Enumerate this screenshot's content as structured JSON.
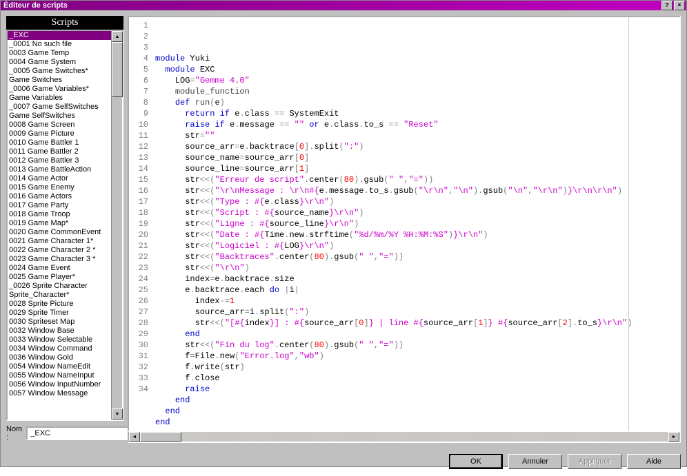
{
  "window": {
    "title": "Éditeur de scripts"
  },
  "sidebar": {
    "header": "Scripts",
    "name_label": "Nom :",
    "name_value": "_EXC",
    "items": [
      "_EXC",
      "_0001 No such file",
      "0003 Game Temp",
      "0004 Game System",
      "_0005 Game Switches*",
      "Game Switches",
      "_0006 Game Variables*",
      "Game Variables",
      "_0007 Game SelfSwitches",
      "Game SelfSwitches",
      "0008 Game Screen",
      "0009 Game Picture",
      "0010 Game Battler 1",
      "0011 Game Battler 2",
      "0012 Game Battler 3",
      "0013 Game BattleAction",
      "0014 Game Actor",
      "0015 Game Enemy",
      "0016 Game Actors",
      "0017 Game Party",
      "0018 Game Troop",
      "0019 Game Map*",
      "0020 Game CommonEvent",
      "0021 Game Character 1*",
      "0022 Game Character 2 *",
      "0023 Game Character 3 *",
      "0024 Game Event",
      "0025 Game Player*",
      "_0026 Sprite Character",
      "Sprite_Character*",
      "0028 Sprite Picture",
      "0029 Sprite Timer",
      "0030 Spriteset Map",
      "0032 Window Base",
      "0033 Window Selectable",
      "0034 Window Command",
      "0036 Window Gold",
      "0054 Window NameEdit",
      "0055 Window NameInput",
      "0056 Window InputNumber",
      "0057 Window Message"
    ],
    "selected_index": 0
  },
  "code": {
    "lines": [
      [
        [
          "kw",
          "module"
        ],
        [
          "id",
          " Yuki"
        ]
      ],
      [
        [
          "id",
          "  "
        ],
        [
          "kw",
          "module"
        ],
        [
          "id",
          " EXC"
        ]
      ],
      [
        [
          "id",
          "    LOG"
        ],
        [
          "op",
          "="
        ],
        [
          "str",
          "\"Gemme 4.0\""
        ]
      ],
      [
        [
          "id",
          "    "
        ],
        [
          "def",
          "module_function"
        ]
      ],
      [
        [
          "id",
          "    "
        ],
        [
          "kw",
          "def"
        ],
        [
          "id",
          " "
        ],
        [
          "def",
          "run"
        ],
        [
          "op",
          "("
        ],
        [
          "id",
          "e"
        ],
        [
          "op",
          ")"
        ]
      ],
      [
        [
          "id",
          "      "
        ],
        [
          "kw",
          "return"
        ],
        [
          "id",
          " "
        ],
        [
          "kw",
          "if"
        ],
        [
          "id",
          " e"
        ],
        [
          "op",
          "."
        ],
        [
          "id",
          "class "
        ],
        [
          "op",
          "=="
        ],
        [
          "id",
          " SystemExit"
        ]
      ],
      [
        [
          "id",
          "      "
        ],
        [
          "kw",
          "raise"
        ],
        [
          "id",
          " "
        ],
        [
          "kw",
          "if"
        ],
        [
          "id",
          " e"
        ],
        [
          "op",
          "."
        ],
        [
          "id",
          "message "
        ],
        [
          "op",
          "=="
        ],
        [
          "id",
          " "
        ],
        [
          "str",
          "\"\""
        ],
        [
          "id",
          " "
        ],
        [
          "kw",
          "or"
        ],
        [
          "id",
          " e"
        ],
        [
          "op",
          "."
        ],
        [
          "id",
          "class"
        ],
        [
          "op",
          "."
        ],
        [
          "id",
          "to_s "
        ],
        [
          "op",
          "=="
        ],
        [
          "id",
          " "
        ],
        [
          "str",
          "\"Reset\""
        ]
      ],
      [
        [
          "id",
          "      str"
        ],
        [
          "op",
          "="
        ],
        [
          "str",
          "\"\""
        ]
      ],
      [
        [
          "id",
          "      source_arr"
        ],
        [
          "op",
          "="
        ],
        [
          "id",
          "e"
        ],
        [
          "op",
          "."
        ],
        [
          "id",
          "backtrace"
        ],
        [
          "op",
          "["
        ],
        [
          "num",
          "0"
        ],
        [
          "op",
          "]."
        ],
        [
          "id",
          "split"
        ],
        [
          "op",
          "("
        ],
        [
          "str",
          "\":\""
        ],
        [
          "op",
          ")"
        ]
      ],
      [
        [
          "id",
          "      source_name"
        ],
        [
          "op",
          "="
        ],
        [
          "id",
          "source_arr"
        ],
        [
          "op",
          "["
        ],
        [
          "num",
          "0"
        ],
        [
          "op",
          "]"
        ]
      ],
      [
        [
          "id",
          "      source_line"
        ],
        [
          "op",
          "="
        ],
        [
          "id",
          "source_arr"
        ],
        [
          "op",
          "["
        ],
        [
          "num",
          "1"
        ],
        [
          "op",
          "]"
        ]
      ],
      [
        [
          "id",
          "      str"
        ],
        [
          "op",
          "<<("
        ],
        [
          "str",
          "\"Erreur de script\""
        ],
        [
          "op",
          "."
        ],
        [
          "id",
          "center"
        ],
        [
          "op",
          "("
        ],
        [
          "num",
          "80"
        ],
        [
          "op",
          ")."
        ],
        [
          "id",
          "gsub"
        ],
        [
          "op",
          "("
        ],
        [
          "str",
          "\" \""
        ],
        [
          "op",
          ","
        ],
        [
          "str",
          "\"=\""
        ],
        [
          "op",
          "))"
        ]
      ],
      [
        [
          "id",
          "      str"
        ],
        [
          "op",
          "<<("
        ],
        [
          "str",
          "\"\\r\\nMessage : \\r\\n#{"
        ],
        [
          "id",
          "e"
        ],
        [
          "op",
          "."
        ],
        [
          "id",
          "message"
        ],
        [
          "op",
          "."
        ],
        [
          "id",
          "to_s"
        ],
        [
          "op",
          "."
        ],
        [
          "id",
          "gsub"
        ],
        [
          "op",
          "("
        ],
        [
          "str",
          "\"\\r\\n\""
        ],
        [
          "op",
          ","
        ],
        [
          "str",
          "\"\\n\""
        ],
        [
          "op",
          ")."
        ],
        [
          "id",
          "gsub"
        ],
        [
          "op",
          "("
        ],
        [
          "str",
          "\"\\n\""
        ],
        [
          "op",
          ","
        ],
        [
          "str",
          "\"\\r\\n\""
        ],
        [
          "op",
          ")"
        ],
        [
          "str",
          "}\\r\\n\\r\\n\""
        ],
        [
          "op",
          ")"
        ]
      ],
      [
        [
          "id",
          "      str"
        ],
        [
          "op",
          "<<("
        ],
        [
          "str",
          "\"Type : #{"
        ],
        [
          "id",
          "e"
        ],
        [
          "op",
          "."
        ],
        [
          "id",
          "class"
        ],
        [
          "str",
          "}\\r\\n\""
        ],
        [
          "op",
          ")"
        ]
      ],
      [
        [
          "id",
          "      str"
        ],
        [
          "op",
          "<<("
        ],
        [
          "str",
          "\"Script : #{"
        ],
        [
          "id",
          "source_name"
        ],
        [
          "str",
          "}\\r\\n\""
        ],
        [
          "op",
          ")"
        ]
      ],
      [
        [
          "id",
          "      str"
        ],
        [
          "op",
          "<<("
        ],
        [
          "str",
          "\"Ligne : #{"
        ],
        [
          "id",
          "source_line"
        ],
        [
          "str",
          "}\\r\\n\""
        ],
        [
          "op",
          ")"
        ]
      ],
      [
        [
          "id",
          "      str"
        ],
        [
          "op",
          "<<("
        ],
        [
          "str",
          "\"Date : #{"
        ],
        [
          "id",
          "Time"
        ],
        [
          "op",
          "."
        ],
        [
          "id",
          "new"
        ],
        [
          "op",
          "."
        ],
        [
          "id",
          "strftime"
        ],
        [
          "op",
          "("
        ],
        [
          "str",
          "\"%d/%m/%Y %H:%M:%S\""
        ],
        [
          "op",
          ")"
        ],
        [
          "str",
          "}\\r\\n\""
        ],
        [
          "op",
          ")"
        ]
      ],
      [
        [
          "id",
          "      str"
        ],
        [
          "op",
          "<<("
        ],
        [
          "str",
          "\"Logiciel : #{"
        ],
        [
          "id",
          "LOG"
        ],
        [
          "str",
          "}\\r\\n\""
        ],
        [
          "op",
          ")"
        ]
      ],
      [
        [
          "id",
          "      str"
        ],
        [
          "op",
          "<<("
        ],
        [
          "str",
          "\"Backtraces\""
        ],
        [
          "op",
          "."
        ],
        [
          "id",
          "center"
        ],
        [
          "op",
          "("
        ],
        [
          "num",
          "80"
        ],
        [
          "op",
          ")."
        ],
        [
          "id",
          "gsub"
        ],
        [
          "op",
          "("
        ],
        [
          "str",
          "\" \""
        ],
        [
          "op",
          ","
        ],
        [
          "str",
          "\"=\""
        ],
        [
          "op",
          "))"
        ]
      ],
      [
        [
          "id",
          "      str"
        ],
        [
          "op",
          "<<("
        ],
        [
          "str",
          "\"\\r\\n\""
        ],
        [
          "op",
          ")"
        ]
      ],
      [
        [
          "id",
          "      index"
        ],
        [
          "op",
          "="
        ],
        [
          "id",
          "e"
        ],
        [
          "op",
          "."
        ],
        [
          "id",
          "backtrace"
        ],
        [
          "op",
          "."
        ],
        [
          "id",
          "size"
        ]
      ],
      [
        [
          "id",
          "      e"
        ],
        [
          "op",
          "."
        ],
        [
          "id",
          "backtrace"
        ],
        [
          "op",
          "."
        ],
        [
          "id",
          "each "
        ],
        [
          "kw",
          "do"
        ],
        [
          "id",
          " "
        ],
        [
          "op",
          "|"
        ],
        [
          "id",
          "i"
        ],
        [
          "op",
          "|"
        ]
      ],
      [
        [
          "id",
          "        index"
        ],
        [
          "op",
          "-="
        ],
        [
          "num",
          "1"
        ]
      ],
      [
        [
          "id",
          "        source_arr"
        ],
        [
          "op",
          "="
        ],
        [
          "id",
          "i"
        ],
        [
          "op",
          "."
        ],
        [
          "id",
          "split"
        ],
        [
          "op",
          "("
        ],
        [
          "str",
          "\":\""
        ],
        [
          "op",
          ")"
        ]
      ],
      [
        [
          "id",
          "        str"
        ],
        [
          "op",
          "<<("
        ],
        [
          "str",
          "\"[#{"
        ],
        [
          "id",
          "index"
        ],
        [
          "str",
          "}] : #{"
        ],
        [
          "id",
          "source_arr"
        ],
        [
          "op",
          "["
        ],
        [
          "num",
          "0"
        ],
        [
          "op",
          "]"
        ],
        [
          "str",
          "} | line #{"
        ],
        [
          "id",
          "source_arr"
        ],
        [
          "op",
          "["
        ],
        [
          "num",
          "1"
        ],
        [
          "op",
          "]"
        ],
        [
          "str",
          "} #{"
        ],
        [
          "id",
          "source_arr"
        ],
        [
          "op",
          "["
        ],
        [
          "num",
          "2"
        ],
        [
          "op",
          "]."
        ],
        [
          "id",
          "to_s"
        ],
        [
          "str",
          "}\\r\\n\""
        ],
        [
          "op",
          ")"
        ]
      ],
      [
        [
          "id",
          "      "
        ],
        [
          "kw",
          "end"
        ]
      ],
      [
        [
          "id",
          "      str"
        ],
        [
          "op",
          "<<("
        ],
        [
          "str",
          "\"Fin du log\""
        ],
        [
          "op",
          "."
        ],
        [
          "id",
          "center"
        ],
        [
          "op",
          "("
        ],
        [
          "num",
          "80"
        ],
        [
          "op",
          ")."
        ],
        [
          "id",
          "gsub"
        ],
        [
          "op",
          "("
        ],
        [
          "str",
          "\" \""
        ],
        [
          "op",
          ","
        ],
        [
          "str",
          "\"=\""
        ],
        [
          "op",
          "))"
        ]
      ],
      [
        [
          "id",
          "      f"
        ],
        [
          "op",
          "="
        ],
        [
          "id",
          "File"
        ],
        [
          "op",
          "."
        ],
        [
          "id",
          "new"
        ],
        [
          "op",
          "("
        ],
        [
          "str",
          "\"Error.log\""
        ],
        [
          "op",
          ","
        ],
        [
          "str",
          "\"wb\""
        ],
        [
          "op",
          ")"
        ]
      ],
      [
        [
          "id",
          "      f"
        ],
        [
          "op",
          "."
        ],
        [
          "id",
          "write"
        ],
        [
          "op",
          "("
        ],
        [
          "id",
          "str"
        ],
        [
          "op",
          ")"
        ]
      ],
      [
        [
          "id",
          "      f"
        ],
        [
          "op",
          "."
        ],
        [
          "id",
          "close"
        ]
      ],
      [
        [
          "id",
          "      "
        ],
        [
          "kw",
          "raise"
        ]
      ],
      [
        [
          "id",
          "    "
        ],
        [
          "kw",
          "end"
        ]
      ],
      [
        [
          "id",
          "  "
        ],
        [
          "kw",
          "end"
        ]
      ],
      [
        [
          "kw",
          "end"
        ]
      ]
    ]
  },
  "buttons": {
    "ok": "OK",
    "cancel": "Annuler",
    "apply": "Appliquer",
    "help": "Aide"
  }
}
